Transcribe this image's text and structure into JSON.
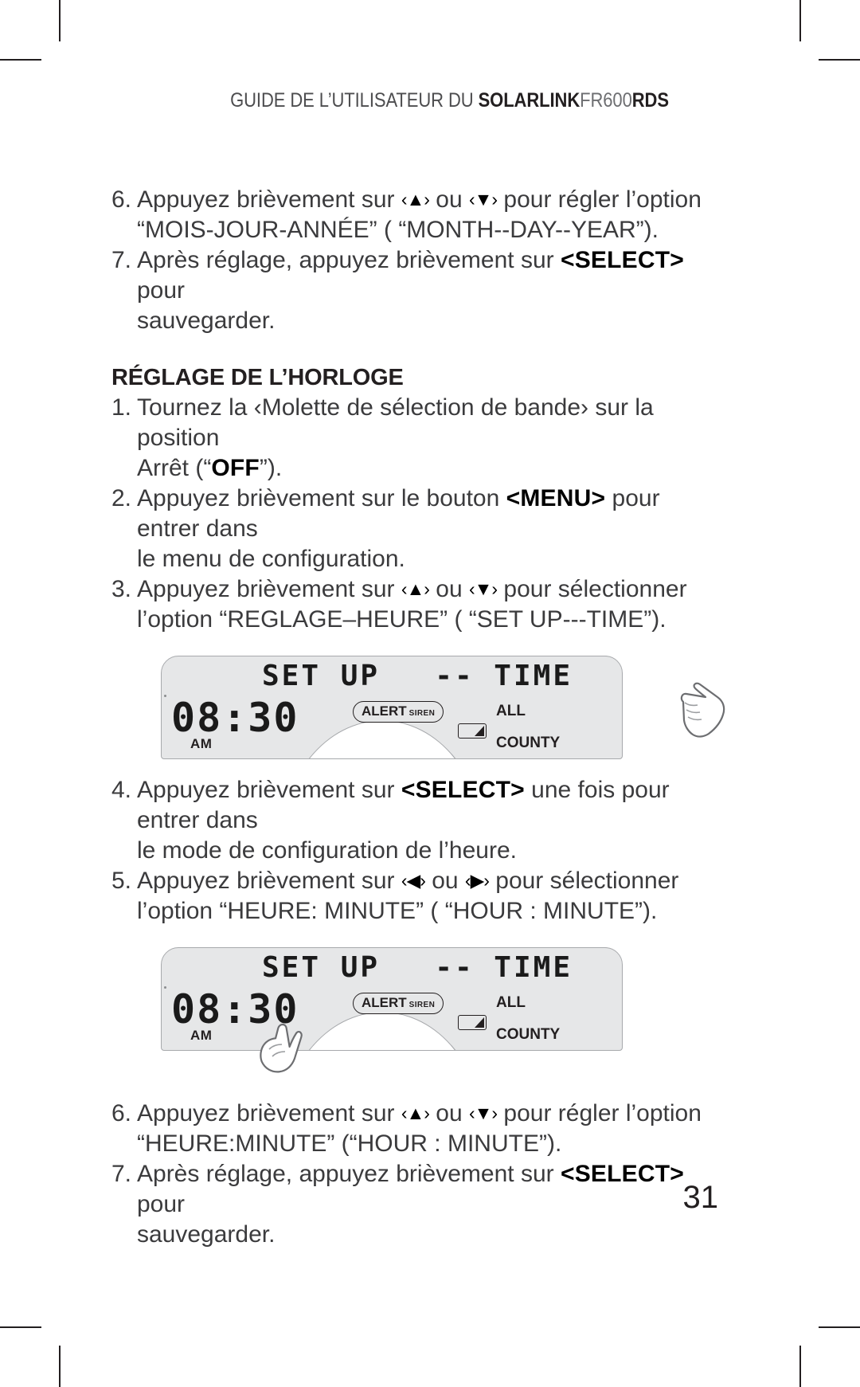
{
  "header": {
    "prefix": "GUIDE DE L’UTILISATEUR DU ",
    "brand": "SOLARLINK",
    "model": "FR600",
    "suffix": "RDS"
  },
  "steps_top": [
    {
      "num": "6.",
      "line1_a": "Appuyez brièvement sur ",
      "line1_arrow_up": "‹▲›",
      "line1_b": " ou ",
      "line1_arrow_down": "‹▼›",
      "line1_c": " pour régler l’option",
      "line2": "“MOIS-JOUR-ANNÉE” ( “MONTH--DAY--YEAR”)."
    },
    {
      "num": "7.",
      "line1_a": "Après réglage, appuyez brièvement sur ",
      "bold": "<SELECT>",
      "line1_c": " pour",
      "line2": "sauvegarder."
    }
  ],
  "section": {
    "title": "RÉGLAGE DE L’HORLOGE"
  },
  "steps_clock": [
    {
      "num": "1.",
      "line1": "Tournez la ‹Molette de sélection de bande› sur la position",
      "line2_a": "Arrêt (“",
      "line2_bold": "OFF",
      "line2_b": "”)."
    },
    {
      "num": "2.",
      "line1_a": "Appuyez brièvement sur le bouton ",
      "bold": "<MENU>",
      "line1_c": " pour entrer dans",
      "line2": "le menu de configuration."
    },
    {
      "num": "3.",
      "line1_a": "Appuyez brièvement sur ",
      "line1_arrow_up": "‹▲›",
      "line1_b": " ou ",
      "line1_arrow_down": "‹▼›",
      "line1_c": " pour sélectionner",
      "line2": "l’option “REGLAGE–HEURE” ( “SET UP---TIME”)."
    }
  ],
  "lcd_first": {
    "set_up": "SET UP",
    "time_label": "-- TIME",
    "clock": "08:30",
    "ampm": "AM",
    "alert": "ALERT",
    "siren": "SIREN",
    "all": "ALL",
    "county": "COUNTY"
  },
  "steps_mid": [
    {
      "num": "4.",
      "line1_a": "Appuyez brièvement sur ",
      "bold": "<SELECT>",
      "line1_c": " une fois pour entrer dans",
      "line2": "le mode de configuration de l’heure."
    },
    {
      "num": "5.",
      "line1_a": "Appuyez brièvement sur  ",
      "line1_arrow_left": "‹◀›",
      "line1_b": " ou ",
      "line1_arrow_right": "‹▶›",
      "line1_c": " pour sélectionner",
      "line2": "l’option “HEURE: MINUTE” ( “HOUR : MINUTE”)."
    }
  ],
  "lcd_second": {
    "set_up": "SET UP",
    "time_label": "-- TIME",
    "clock": "08:30",
    "ampm": "AM",
    "alert": "ALERT",
    "siren": "SIREN",
    "all": "ALL",
    "county": "COUNTY"
  },
  "steps_bottom": [
    {
      "num": "6.",
      "line1_a": "Appuyez brièvement sur ",
      "line1_arrow_up": "‹▲›",
      "line1_b": " ou ",
      "line1_arrow_down": "‹▼›",
      "line1_c": " pour régler l’option",
      "line2": "“HEURE:MINUTE” (“HOUR : MINUTE”)."
    },
    {
      "num": "7.",
      "line1_a": "Après réglage, appuyez brièvement sur ",
      "bold": "<SELECT>",
      "line1_c": " pour",
      "line2": "sauvegarder."
    }
  ],
  "page_number": "31",
  "colors": {
    "text": "#3b3b3d",
    "lcd_bg": "#e6e7e8",
    "lcd_border": "#a7a9ac"
  }
}
